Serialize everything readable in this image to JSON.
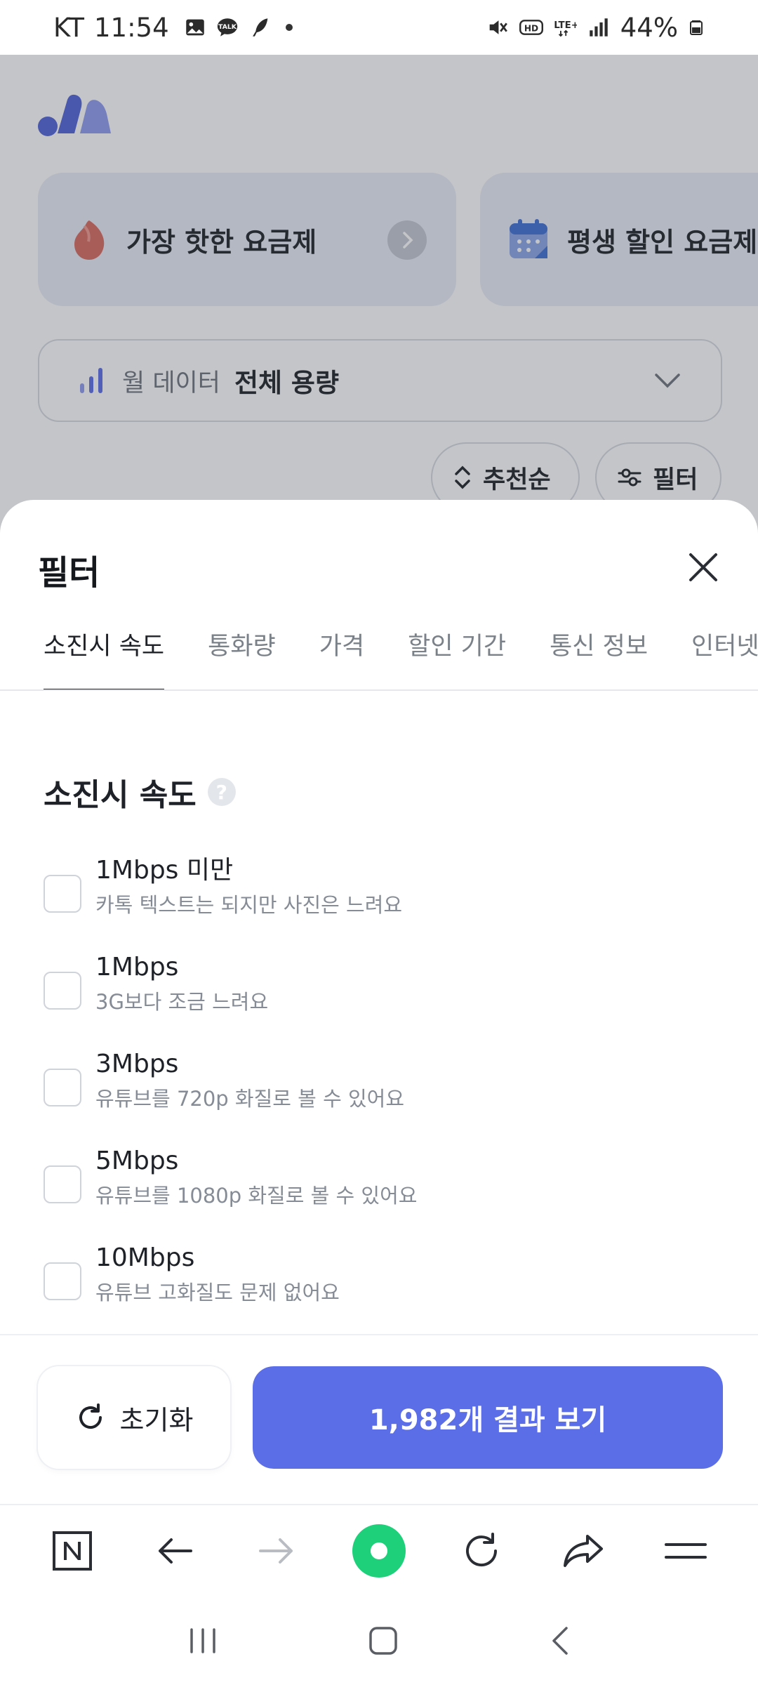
{
  "status_bar": {
    "carrier": "KT",
    "time": "11:54",
    "battery": "44%",
    "icons_left": [
      "gallery-icon",
      "talk-icon",
      "feather-icon"
    ],
    "icons_right": [
      "mute-icon",
      "hd-icon",
      "lte-icon",
      "signal-icon",
      "battery-icon"
    ]
  },
  "page": {
    "promo_cards": [
      {
        "title": "가장 핫한 요금제",
        "icon": "flame-icon"
      },
      {
        "title": "평생 할인 요금제",
        "icon": "calendar-icon"
      }
    ],
    "data_select": {
      "label": "월 데이터",
      "value": "전체 용량"
    },
    "sort_label": "추천순",
    "filter_label": "필터"
  },
  "sheet": {
    "title": "필터",
    "tabs": [
      {
        "label": "소진시 속도",
        "active": true
      },
      {
        "label": "통화량",
        "active": false
      },
      {
        "label": "가격",
        "active": false
      },
      {
        "label": "할인 기간",
        "active": false
      },
      {
        "label": "통신 정보",
        "active": false
      },
      {
        "label": "인터넷",
        "active": false
      }
    ],
    "section_title": "소진시 속도",
    "help_symbol": "?",
    "options": [
      {
        "title": "1Mbps 미만",
        "subtitle": "카톡 텍스트는 되지만 사진은 느려요",
        "checked": false
      },
      {
        "title": "1Mbps",
        "subtitle": "3G보다 조금 느려요",
        "checked": false
      },
      {
        "title": "3Mbps",
        "subtitle": "유튜브를 720p 화질로 볼 수 있어요",
        "checked": false
      },
      {
        "title": "5Mbps",
        "subtitle": "유튜브를 1080p 화질로 볼 수 있어요",
        "checked": false
      },
      {
        "title": "10Mbps",
        "subtitle": "유튜브 고화질도 문제 없어요",
        "checked": false
      }
    ],
    "reset_label": "초기화",
    "result_label": "1,982개 결과 보기"
  },
  "browser_bar": {
    "buttons": [
      "naver-home-icon",
      "back-arrow-icon",
      "forward-arrow-icon",
      "green-dot-icon",
      "refresh-icon",
      "share-icon",
      "menu-icon"
    ]
  },
  "nav_bar": {
    "buttons": [
      "recents-icon",
      "home-icon",
      "back-icon"
    ]
  },
  "colors": {
    "primary": "#5b6ee8",
    "text": "#1e2228",
    "subtext": "#868c95",
    "green": "#1fd07a",
    "flame": "#d86a60"
  }
}
